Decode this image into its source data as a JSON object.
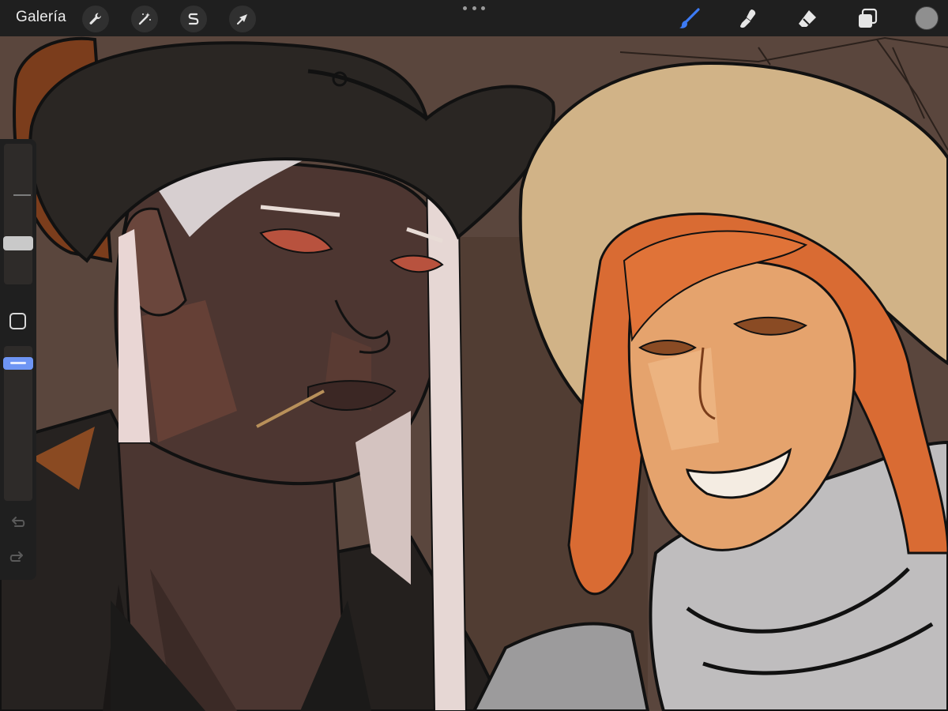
{
  "app": {
    "gallery_label": "Galería"
  },
  "toolbar_left": {
    "actions_icon": "wrench-icon",
    "adjustments_icon": "magic-wand-icon",
    "selection_icon": "selection-s-icon",
    "transform_icon": "arrow-cursor-icon"
  },
  "toolbar_right": {
    "brush_icon": "brush-icon",
    "smudge_icon": "smudge-finger-icon",
    "eraser_icon": "eraser-icon",
    "layers_icon": "layers-icon",
    "color_icon": "color-circle-icon"
  },
  "colors": {
    "toolbar_bg": "#1f1f1f",
    "active_tool": "#3d7bf5",
    "current_color": "#8f8f8f",
    "opacity_slider_accent": "#6e95f4"
  },
  "sidebar": {
    "brush_size_level": 0.3,
    "opacity_level": 0.85,
    "modify_button_icon": "square-outline-icon",
    "undo_icon": "undo-arrow-icon",
    "redo_icon": "redo-arrow-icon"
  }
}
